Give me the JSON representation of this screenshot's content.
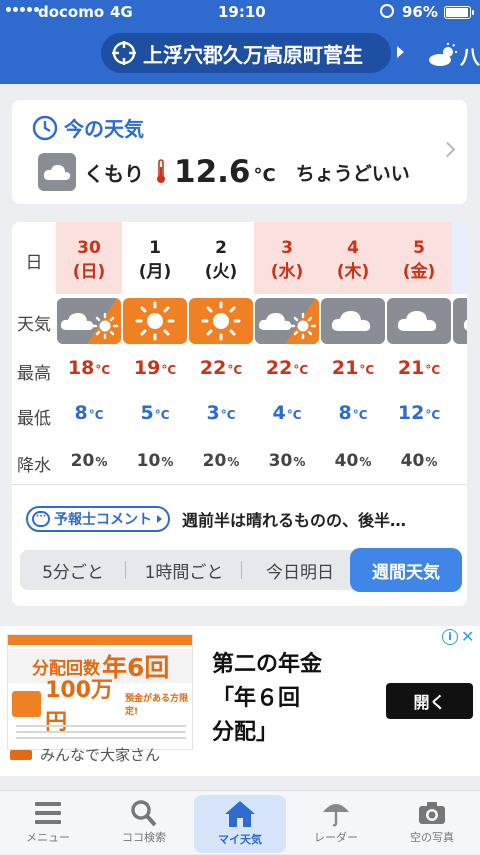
{
  "status_bar": {
    "carrier": "docomo",
    "network": "4G",
    "time": "19:10",
    "battery": "96%"
  },
  "header": {
    "location": "上浮穴郡久万高原町菅生",
    "next_location": "八"
  },
  "now": {
    "title": "今の天気",
    "condition": "くもり",
    "temperature": "12.6",
    "unit": "°C",
    "feel": "ちょうどいい"
  },
  "week": {
    "row_labels": {
      "day": "日",
      "weather": "天気",
      "high": "最高",
      "low": "最低",
      "rain": "降水"
    },
    "days": [
      {
        "date": "30",
        "weekday": "(日)",
        "weekend": true,
        "icon": "cloud-sun",
        "high": "18",
        "low": "8",
        "rain": "20"
      },
      {
        "date": "1",
        "weekday": "(月)",
        "weekend": false,
        "icon": "sun",
        "high": "19",
        "low": "5",
        "rain": "10"
      },
      {
        "date": "2",
        "weekday": "(火)",
        "weekend": false,
        "icon": "sun",
        "high": "22",
        "low": "3",
        "rain": "20"
      },
      {
        "date": "3",
        "weekday": "(水)",
        "weekend": true,
        "icon": "cloud-sun",
        "high": "22",
        "low": "4",
        "rain": "30"
      },
      {
        "date": "4",
        "weekday": "(木)",
        "weekend": true,
        "icon": "cloud",
        "high": "21",
        "low": "8",
        "rain": "40"
      },
      {
        "date": "5",
        "weekday": "(金)",
        "weekend": true,
        "icon": "cloud",
        "high": "21",
        "low": "12",
        "rain": "40"
      }
    ],
    "temp_unit": "°C",
    "rain_unit": "%",
    "comment_label": "予報士コメント",
    "comment_text": "週前半は晴れるものの、後半…",
    "tabs": [
      "5分ごと",
      "1時間ごと",
      "今日明日",
      "週間天気"
    ]
  },
  "ad": {
    "flyer_title_pre": "分配回数",
    "flyer_title_num": "年6回",
    "flyer_amount": "100万円",
    "flyer_note": "預金がある方限定!",
    "brand": "みんなで大家さん",
    "headline_1": "第二の年金",
    "headline_2": "「年６回",
    "headline_3": "分配」",
    "open_button": "開く"
  },
  "tabbar": [
    "メニュー",
    "ココ検索",
    "マイ天気",
    "レーダー",
    "空の写真"
  ],
  "colors": {
    "brand_blue": "#2f6bcf",
    "sunny_orange": "#f08024",
    "cloudy_gray": "#8a8d93",
    "weekend_bg": "#fbe1de",
    "high_red": "#c9331c"
  }
}
